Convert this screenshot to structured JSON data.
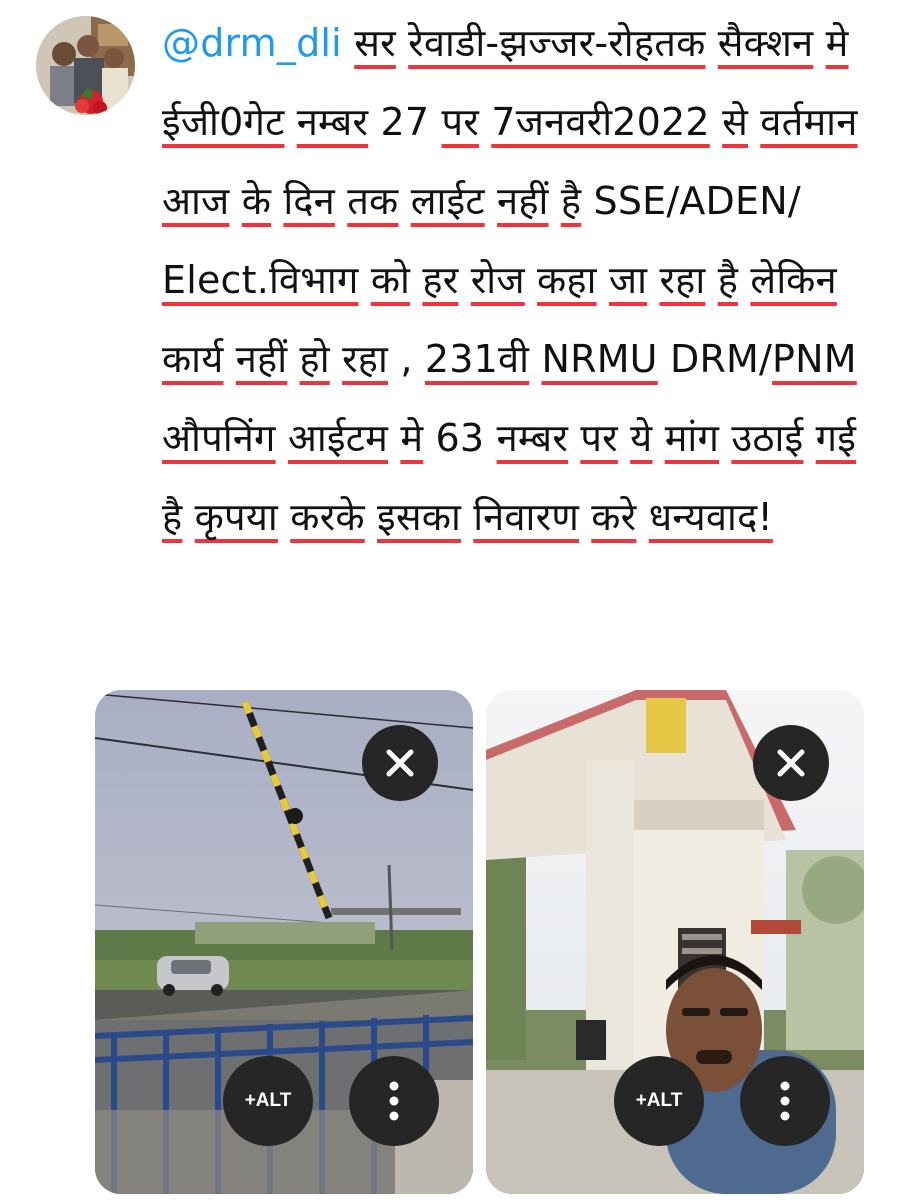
{
  "tweet": {
    "handle": "@drm_dli",
    "words": [
      "सर",
      "रेवाडी-झज्जर-रोहतक",
      "सैक्शन",
      "मे",
      "ईजी0गेट",
      "नम्बर",
      "27",
      "पर",
      "7जनवरी2022",
      "से",
      "वर्तमान",
      "आज",
      "के",
      "दिन",
      "तक",
      "लाईट",
      "नहीं",
      "है",
      "SSE/ADEN/",
      "Elect.विभाग",
      "को",
      "हर",
      "रोज",
      "कहा",
      "जा",
      "रहा",
      "है",
      "लेकिन",
      "कार्य",
      "नहीं",
      "हो",
      "रहा",
      ",",
      "231वी",
      "NRMU",
      "DRM/PNM",
      "औपनिंग",
      "आईटम",
      "मे",
      "63",
      "नम्बर",
      "पर",
      "ये",
      "मांग",
      "उठाई",
      "गई",
      "है",
      "कृपया",
      "करके",
      "इसका",
      "निवारण",
      "करे",
      "धन्यवाद!"
    ]
  },
  "media": [
    {
      "close_icon": "close-icon",
      "alt_label": "+ALT",
      "more_icon": "more-vertical-icon"
    },
    {
      "close_icon": "close-icon",
      "alt_label": "+ALT",
      "more_icon": "more-vertical-icon"
    }
  ],
  "colors": {
    "mention": "#1d9bf0",
    "spellcheck_underline": "#f0343c",
    "button_bg": "#262626",
    "text": "#111111"
  }
}
